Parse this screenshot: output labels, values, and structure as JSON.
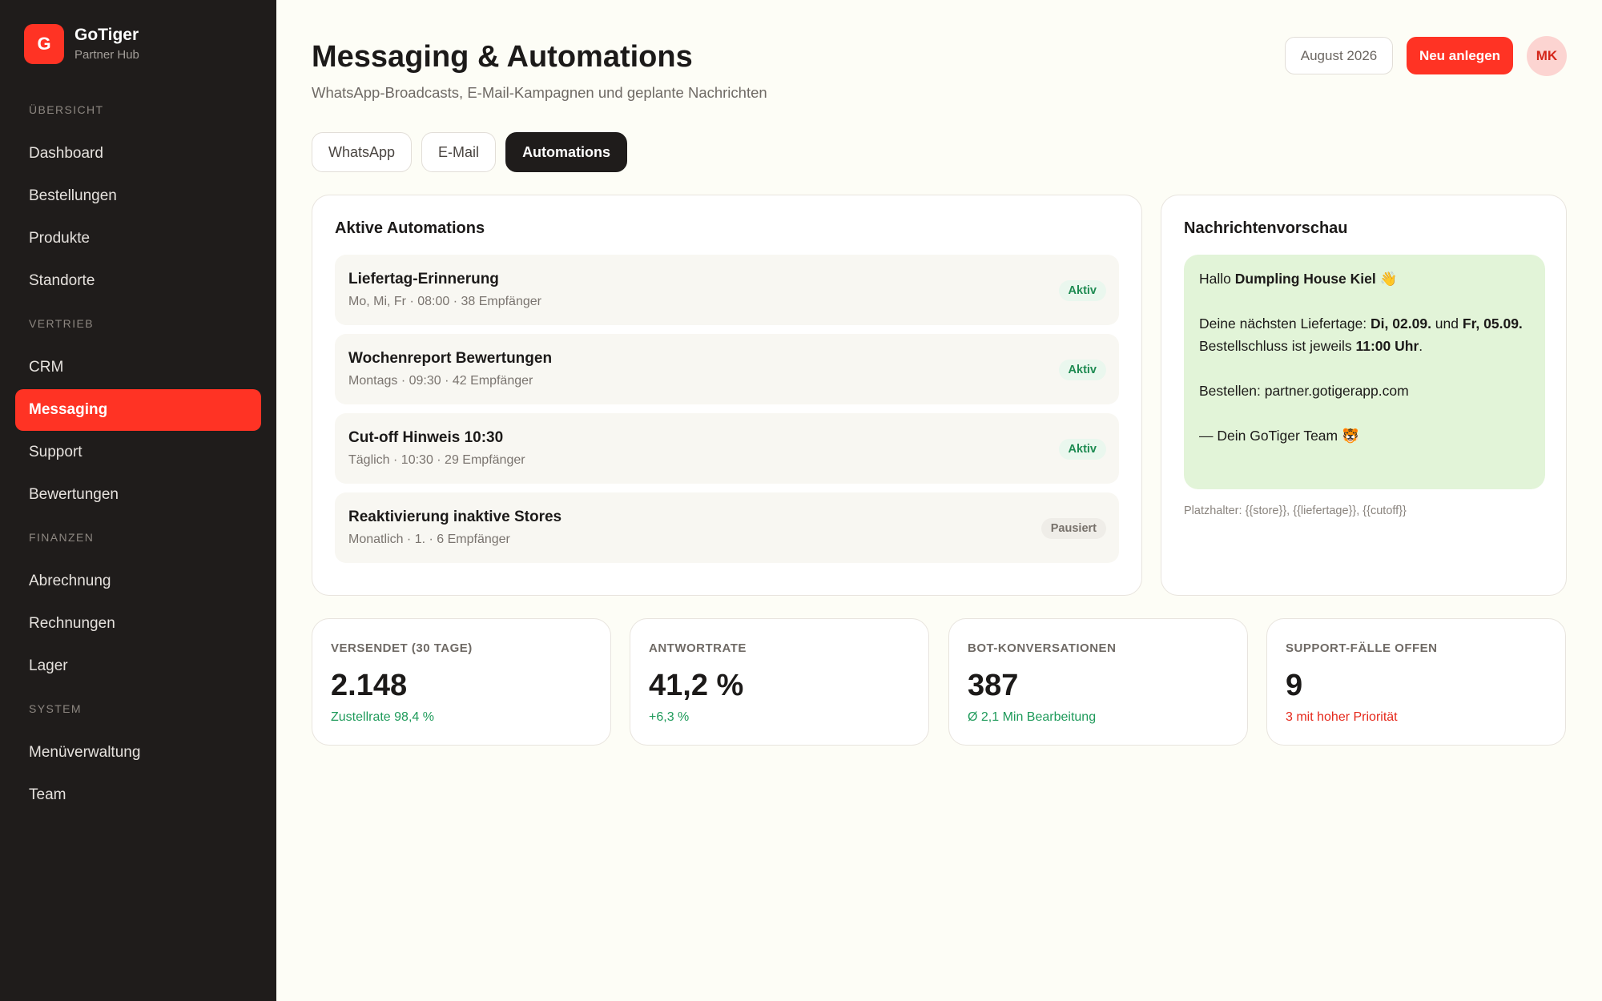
{
  "brand": {
    "logo_letter": "G",
    "name": "GoTiger",
    "sub": "Partner Hub"
  },
  "nav": {
    "sections": [
      {
        "label": "ÜBERSICHT",
        "items": [
          "Dashboard",
          "Bestellungen",
          "Produkte",
          "Standorte"
        ]
      },
      {
        "label": "VERTRIEB",
        "items": [
          "CRM",
          "Messaging",
          "Support",
          "Bewertungen"
        ]
      },
      {
        "label": "FINANZEN",
        "items": [
          "Abrechnung",
          "Rechnungen",
          "Lager"
        ]
      },
      {
        "label": "SYSTEM",
        "items": [
          "Menüverwaltung",
          "Team"
        ]
      }
    ],
    "active": "Messaging"
  },
  "header": {
    "title": "Messaging & Automations",
    "subtitle": "WhatsApp-Broadcasts, E-Mail-Kampagnen und geplante Nachrichten",
    "month": "August 2026",
    "new_label": "Neu anlegen",
    "avatar": "MK"
  },
  "tabs": [
    {
      "label": "WhatsApp",
      "active": false
    },
    {
      "label": "E-Mail",
      "active": false
    },
    {
      "label": "Automations",
      "active": true
    }
  ],
  "automations": {
    "title": "Aktive Automations",
    "items": [
      {
        "name": "Liefertag-Erinnerung",
        "meta": "Mo, Mi, Fr · 08:00 · 38 Empfänger",
        "status": "Aktiv"
      },
      {
        "name": "Wochenreport Bewertungen",
        "meta": "Montags · 09:30 · 42 Empfänger",
        "status": "Aktiv"
      },
      {
        "name": "Cut-off Hinweis 10:30",
        "meta": "Täglich · 10:30 · 29 Empfänger",
        "status": "Aktiv"
      },
      {
        "name": "Reaktivierung inaktive Stores",
        "meta": "Monatlich · 1. · 6 Empfänger",
        "status": "Pausiert"
      }
    ]
  },
  "preview": {
    "title": "Nachrichtenvorschau",
    "greeting_prefix": "Hallo ",
    "store": "Dumpling House Kiel",
    "greeting_emoji": "👋",
    "line2_prefix": "Deine nächsten Liefertage: ",
    "date1": "Di, 02.09.",
    "and": " und ",
    "date2": "Fr, 05.09.",
    "line3_prefix": "Bestellschluss ist jeweils ",
    "cutoff": "11:00 Uhr",
    "line3_suffix": ".",
    "order_line": "Bestellen: partner.gotigerapp.com",
    "signoff": "— Dein GoTiger Team",
    "signoff_emoji": "🐯",
    "placeholder_note": "Platzhalter: {{store}}, {{liefertage}}, {{cutoff}}"
  },
  "stats": [
    {
      "label": "VERSENDET (30 TAGE)",
      "value": "2.148",
      "note": "Zustellrate 98,4 %",
      "tone": "good"
    },
    {
      "label": "ANTWORTRATE",
      "value": "41,2 %",
      "note": "+6,3 %",
      "tone": "good"
    },
    {
      "label": "BOT-KONVERSATIONEN",
      "value": "387",
      "note": "Ø 2,1 Min Bearbeitung",
      "tone": "good"
    },
    {
      "label": "SUPPORT-FÄLLE OFFEN",
      "value": "9",
      "note": "3 mit hoher Priorität",
      "tone": "bad"
    }
  ],
  "colors": {
    "accent": "#ff3324",
    "sidebar": "#1f1c1b",
    "good": "#1e9a5a",
    "bad": "#e5281b"
  }
}
